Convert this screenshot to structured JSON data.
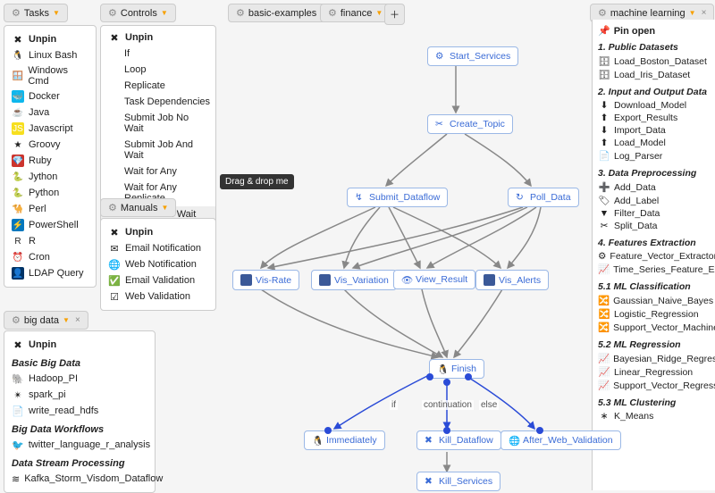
{
  "tabs": {
    "tasks": "Tasks",
    "controls": "Controls",
    "manuals": "Manuals",
    "bigdata": "big data",
    "basic": "basic-examples",
    "finance": "finance",
    "ml": "machine learning"
  },
  "tasks_panel": {
    "unpin": "Unpin",
    "items": [
      "Linux Bash",
      "Windows Cmd",
      "Docker",
      "Java",
      "Javascript",
      "Groovy",
      "Ruby",
      "Jython",
      "Python",
      "Perl",
      "PowerShell",
      "R",
      "Cron",
      "LDAP Query"
    ]
  },
  "controls_panel": {
    "unpin": "Unpin",
    "items": [
      "If",
      "Loop",
      "Replicate",
      "Task Dependencies",
      "Submit Job No Wait",
      "Submit Job And Wait",
      "Wait for Any",
      "Wait for Any Replicate",
      "Submit and Wait for Any"
    ]
  },
  "tooltip": "Drag & drop me",
  "manuals_panel": {
    "unpin": "Unpin",
    "items": [
      "Email Notification",
      "Web Notification",
      "Email Validation",
      "Web Validation"
    ]
  },
  "bigdata_panel": {
    "unpin": "Unpin",
    "sec1": "Basic Big Data",
    "sec1_items": [
      "Hadoop_PI",
      "spark_pi",
      "write_read_hdfs"
    ],
    "sec2": "Big Data Workflows",
    "sec2_items": [
      "twitter_language_r_analysis"
    ],
    "sec3": "Data Stream Processing",
    "sec3_items": [
      "Kafka_Storm_Visdom_Dataflow"
    ]
  },
  "right": {
    "pin": "Pin open",
    "sec1": "1. Public Datasets",
    "sec1_items": [
      "Load_Boston_Dataset",
      "Load_Iris_Dataset"
    ],
    "sec2": "2. Input and Output Data",
    "sec2_items": [
      "Download_Model",
      "Export_Results",
      "Import_Data",
      "Load_Model",
      "Log_Parser"
    ],
    "sec3": "3. Data Preprocessing",
    "sec3_items": [
      "Add_Data",
      "Add_Label",
      "Filter_Data",
      "Split_Data"
    ],
    "sec4": "4. Features Extraction",
    "sec4_items": [
      "Feature_Vector_Extractor",
      "Time_Series_Feature_Extractor"
    ],
    "sec5": "5.1 ML Classification",
    "sec5_items": [
      "Gaussian_Naive_Bayes",
      "Logistic_Regression",
      "Support_Vector_Machines"
    ],
    "sec6": "5.2 ML Regression",
    "sec6_items": [
      "Bayesian_Ridge_Regression",
      "Linear_Regression",
      "Support_Vector_Regression"
    ],
    "sec7": "5.3 ML Clustering",
    "sec7_items": [
      "K_Means"
    ]
  },
  "nodes": {
    "start": "Start_Services",
    "create": "Create_Topic",
    "submit": "Submit_Dataflow",
    "poll": "Poll_Data",
    "visrate": "Vis-Rate",
    "visvar": "Vis_Variation",
    "viewres": "View_Result",
    "visalerts": "Vis_Alerts",
    "finish": "Finish",
    "imm": "Immediately",
    "killdf": "Kill_Dataflow",
    "afterwv": "After_Web_Validation",
    "killsvc": "Kill_Services"
  },
  "cond": {
    "if": "if",
    "cont": "continuation",
    "else": "else"
  }
}
